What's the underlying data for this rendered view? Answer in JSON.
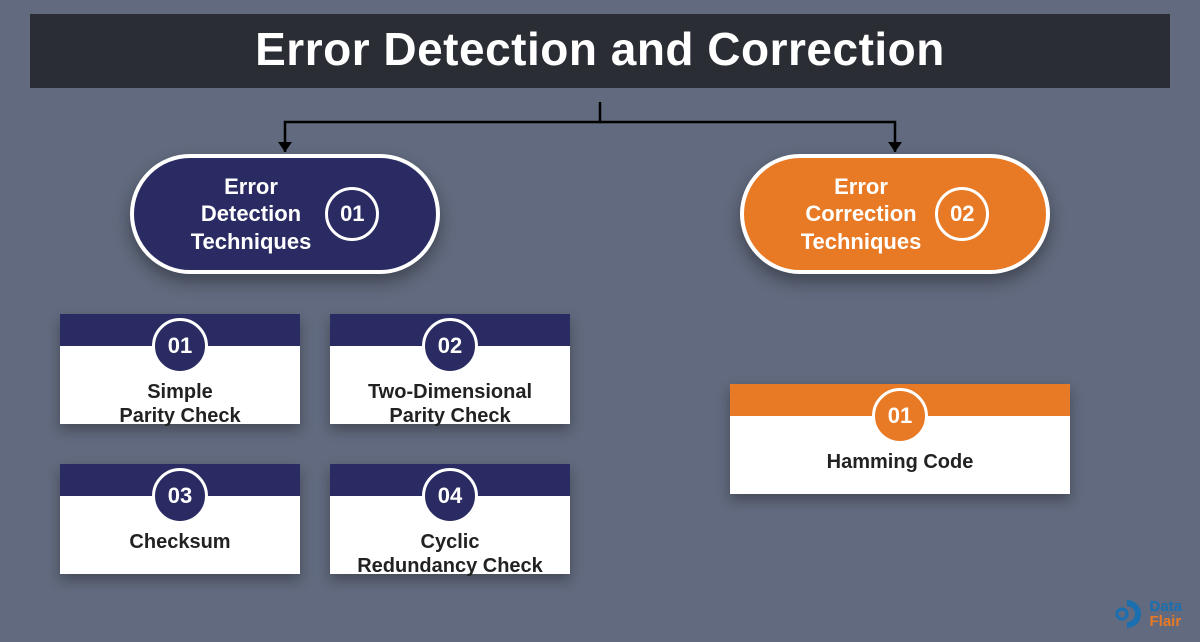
{
  "title": "Error Detection and Correction",
  "branches": {
    "detection": {
      "label": "Error\nDetection\nTechniques",
      "num": "01"
    },
    "correction": {
      "label": "Error\nCorrection\nTechniques",
      "num": "02"
    }
  },
  "detection_cards": [
    {
      "num": "01",
      "label": "Simple\nParity Check"
    },
    {
      "num": "02",
      "label": "Two-Dimensional\nParity Check"
    },
    {
      "num": "03",
      "label": "Checksum"
    },
    {
      "num": "04",
      "label": "Cyclic\nRedundancy Check"
    }
  ],
  "correction_cards": [
    {
      "num": "01",
      "label": "Hamming Code"
    }
  ],
  "logo": {
    "line1": "Data",
    "line2": "Flair"
  }
}
